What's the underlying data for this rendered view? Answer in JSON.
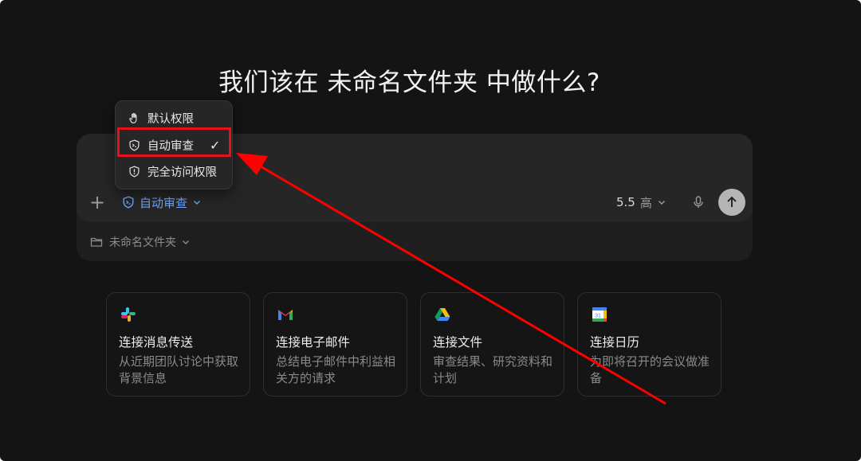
{
  "heading": "我们该在 未命名文件夹 中做什么?",
  "composer": {
    "permission_label": "自动审查",
    "model_version": "5.5",
    "model_effort": "高",
    "folder_label": "未命名文件夹"
  },
  "permission_menu": {
    "items": [
      {
        "label": "默认权限",
        "icon": "hand-icon"
      },
      {
        "label": "自动审查",
        "icon": "terminal-shield-icon",
        "selected": true
      },
      {
        "label": "完全访问权限",
        "icon": "alert-shield-icon"
      }
    ]
  },
  "cards": [
    {
      "title": "连接消息传送",
      "description": "从近期团队讨论中获取背景信息",
      "icon": "slack-icon"
    },
    {
      "title": "连接电子邮件",
      "description": "总结电子邮件中利益相关方的请求",
      "icon": "gmail-icon"
    },
    {
      "title": "连接文件",
      "description": "审查结果、研究资料和计划",
      "icon": "drive-icon"
    },
    {
      "title": "连接日历",
      "description": "为即将召开的会议做准备",
      "icon": "calendar-icon",
      "calendar_day": "31"
    }
  ],
  "colors": {
    "background": "#141414",
    "accent": "#6ea8fe",
    "highlight_box": "#e8101a",
    "annotation_arrow": "#ff0000"
  }
}
